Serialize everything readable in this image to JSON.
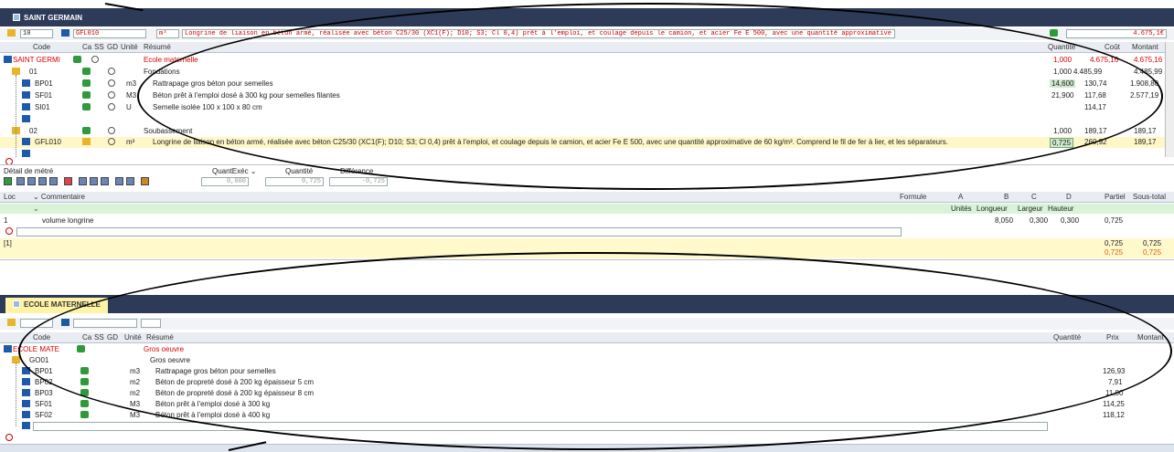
{
  "top_window": {
    "tab_title": "SAINT GERMAIN",
    "formula_bar": {
      "level": "10",
      "code": "GFL010",
      "unit": "m³",
      "text": "Longrine de liaison en béton armé, réalisée avec béton C25/30 (XC1(F); D10; S3; Cl 0,4) prêt à l'emploi, et coulage depuis le camion, et acier Fe E 500, avec une quantité approximative de 60 kg/m³. Comprend le fil de",
      "amount": "4.675,1€"
    },
    "columns": {
      "code": "Code",
      "ca": "Ca",
      "ss": "SS",
      "gd": "GD",
      "unite": "Unité",
      "resume": "Résumé",
      "quantite": "Quantité",
      "cout": "Coût",
      "montant": "Montant"
    },
    "rows": [
      {
        "code": "SAINT GERMI",
        "unit": "",
        "resume": "Ecole maternelle",
        "qty": "1,000",
        "cost": "4.675,16",
        "amount": "4.675,16"
      },
      {
        "code": "01",
        "unit": "",
        "resume": "Fondations",
        "qty": "1,000",
        "cost": "4.485,99",
        "amount": "4.485,99"
      },
      {
        "code": "BP01",
        "unit": "m3",
        "resume": "Rattrapage gros béton pour semelles",
        "qty": "14,600",
        "cost": "130,74",
        "amount": "1.908,80"
      },
      {
        "code": "SF01",
        "unit": "M3",
        "resume": "Béton prêt à l'emploi dosé à 300 kg pour semelles filantes",
        "qty": "21,900",
        "cost": "117,68",
        "amount": "2.577,19"
      },
      {
        "code": "SI01",
        "unit": "U",
        "resume": "Semelle isolée 100 x 100 x 80 cm",
        "qty": "",
        "cost": "114,17",
        "amount": ""
      },
      {
        "code": "",
        "unit": "",
        "resume": "",
        "qty": "",
        "cost": "",
        "amount": ""
      },
      {
        "code": "02",
        "unit": "",
        "resume": "Soubassement",
        "qty": "1,000",
        "cost": "189,17",
        "amount": "189,17"
      },
      {
        "code": "GFL010",
        "unit": "m³",
        "resume": "Longrine de liaison en béton armé, réalisée avec béton C25/30 (XC1(F); D10; S3; Cl 0,4) prêt à l'emploi, et coulage depuis le camion, et acier Fe E 500, avec une quantité approximative de 60 kg/m³. Comprend le fil de fer à lier, et les séparateurs.",
        "qty": "0,725",
        "cost": "260,92",
        "amount": "189,17"
      }
    ]
  },
  "metre": {
    "title": "Détail de métré",
    "quantexec_label": "QuantExéc ⌄",
    "quantite_label": "Quantité",
    "difference_label": "Différence",
    "quantexec_value": "0,000",
    "quantite_value": "0,725",
    "difference_value": "-0,725",
    "columns": {
      "loc": "Loc",
      "commentaire": "⌄ Commentaire",
      "formule": "Formule",
      "a": "A",
      "b": "B",
      "c": "C",
      "d": "D",
      "partiel": "Partiel",
      "sous_total": "Sous-total"
    },
    "subheader": {
      "unites": "Unités",
      "longueur": "Longueur",
      "largeur": "Largeur",
      "hauteur": "Hauteur"
    },
    "line": {
      "loc": "1",
      "commentaire": "volume longrine",
      "b": "8,050",
      "c": "0,300",
      "d": "0,300",
      "partiel": "0,725"
    },
    "total_label": "[1]",
    "total_partiel": "0,725",
    "total_sous": "0,725",
    "total2_partiel": "0,725",
    "total2_sous": "0,725"
  },
  "bottom_window": {
    "tab_title": "ECOLE MATERNELLE",
    "columns": {
      "code": "Code",
      "ca": "Ca",
      "ss": "SS",
      "gd": "GD",
      "unite": "Unité",
      "resume": "Résumé",
      "quantite": "Quantité",
      "prix": "Prix",
      "montant": "Montant"
    },
    "rows": [
      {
        "code": "ECOLE MATE",
        "unit": "",
        "resume": "Gros oeuvre",
        "price": ""
      },
      {
        "code": "GO01",
        "unit": "",
        "resume": "Gros oeuvre",
        "price": ""
      },
      {
        "code": "BP01",
        "unit": "m3",
        "resume": "Rattrapage gros béton pour semelles",
        "price": "126,93"
      },
      {
        "code": "BP02",
        "unit": "m2",
        "resume": "Béton de propreté dosé à 200 kg épaisseur 5 cm",
        "price": "7,91"
      },
      {
        "code": "BP03",
        "unit": "m2",
        "resume": "Béton de propreté dosé à 200 kg épaisseur 8 cm",
        "price": "11,00"
      },
      {
        "code": "SF01",
        "unit": "M3",
        "resume": "Béton prêt à l'emploi dosé à 300 kg",
        "price": "114,25"
      },
      {
        "code": "SF02",
        "unit": "M3",
        "resume": "Béton prêt à l'emploi dosé à 400 kg",
        "price": "118,12"
      }
    ]
  },
  "colors": {
    "titlebar": "#2e3b58",
    "selected_row": "#fff7c8",
    "red_text": "#d00000",
    "header": "#e9edf3"
  }
}
